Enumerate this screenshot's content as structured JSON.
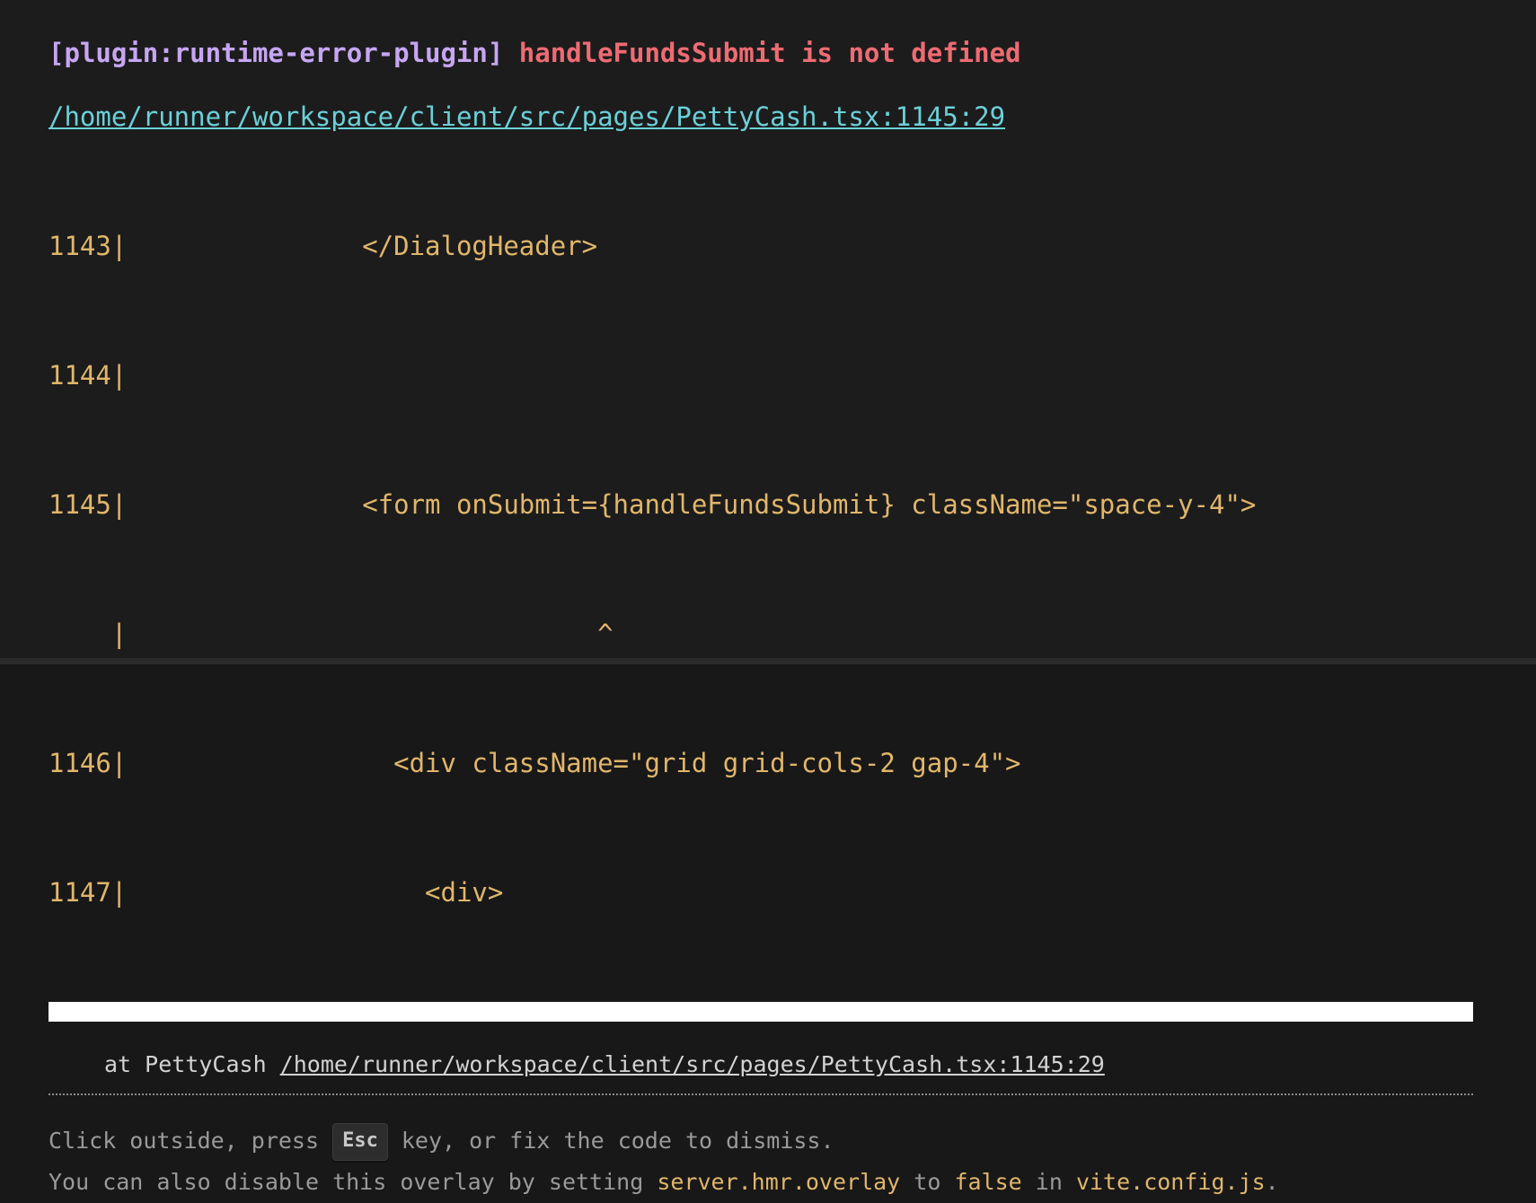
{
  "error": {
    "plugin": "[plugin:runtime-error-plugin]",
    "message": "handleFundsSubmit is not defined",
    "file": "/home/runner/workspace/client/src/pages/PettyCash.tsx:1145:29"
  },
  "frame": {
    "lines": [
      "1143|               </DialogHeader>",
      "1144|",
      "1145|               <form onSubmit={handleFundsSubmit} className=\"space-y-4\">",
      "    |                              ^",
      "1146|                 <div className=\"grid grid-cols-2 gap-4\">",
      "1147|                   <div>"
    ]
  },
  "stack": {
    "prefix": "at PettyCash ",
    "link": "/home/runner/workspace/client/src/pages/PettyCash.tsx:1145:29"
  },
  "tip": {
    "line1_before": "Click outside, press ",
    "key": "Esc",
    "line1_after": " key, or fix the code to dismiss.",
    "line2_before": "You can also disable this overlay by setting ",
    "code1": "server.hmr.overlay",
    "line2_middle1": " to ",
    "code2": "false",
    "line2_middle2": " in ",
    "code3": "vite.config.js",
    "line2_after": "."
  },
  "colors": {
    "background": "#1c1c1c",
    "plugin": "#c6a6f3",
    "message": "#ef6b73",
    "link": "#6bd0d8",
    "code": "#e1b66b",
    "muted": "#9a9a9a"
  }
}
